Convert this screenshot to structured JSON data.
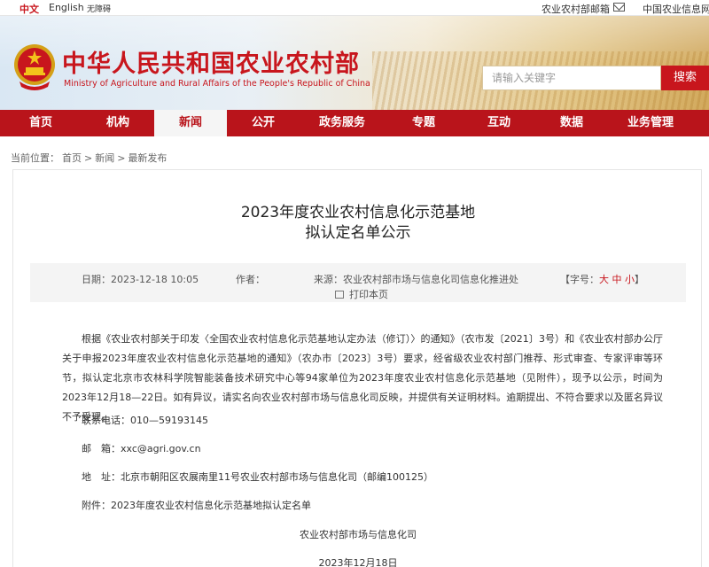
{
  "topbar": {
    "lang_cn": "中文",
    "lang_en": "English",
    "accessibility": "无障碍",
    "mail": "农业农村部邮箱",
    "site": "中国农业信息网"
  },
  "header": {
    "title": "中华人民共和国农业农村部",
    "subtitle": "Ministry of Agriculture and Rural Affairs of the People's Republic of China",
    "search_placeholder": "请输入关键字",
    "search_button": "搜索"
  },
  "nav": {
    "items": [
      "首页",
      "机构",
      "新闻",
      "公开",
      "政务服务",
      "专题",
      "互动",
      "数据",
      "业务管理"
    ],
    "active": "新闻"
  },
  "breadcrumb": {
    "label": "当前位置：",
    "items": [
      "首页",
      ">",
      "新闻",
      ">",
      "最新发布"
    ]
  },
  "article": {
    "title_line1": "2023年度农业农村信息化示范基地",
    "title_line2": "拟认定名单公示",
    "meta": {
      "date_label": "日期：",
      "date": "2023-12-18 10:05",
      "author_label": "作者：",
      "source_label": "来源：",
      "source": "农业农村部市场与信息化司信息化推进处",
      "print": "打印本页",
      "font_label": "【字号：",
      "font_large": "大",
      "font_medium": "中",
      "font_small": "小",
      "font_end": "】"
    },
    "paragraph": "根据《农业农村部关于印发〈全国农业农村信息化示范基地认定办法（修订）〉的通知》（农市发〔2021〕3号）和《农业农村部办公厅关于申报2023年度农业农村信息化示范基地的通知》（农办市〔2023〕3号）要求，经省级农业农村部门推荐、形式审查、专家评审等环节，拟认定北京市农林科学院智能装备技术研究中心等94家单位为2023年度农业农村信息化示范基地（见附件），现予以公示，时间为2023年12月18—22日。如有异议，请实名向农业农村部市场与信息化司反映，并提供有关证明材料。逾期提出、不符合要求以及匿名异议不予受理。",
    "phone": "联系电话：010—59193145",
    "email": "邮　箱：xxc@agri.gov.cn",
    "address": "地　址：北京市朝阳区农展南里11号农业农村部市场与信息化司（邮编100125）",
    "attachment": "附件：2023年度农业农村信息化示范基地拟认定名单",
    "signature": "农业农村部市场与信息化司",
    "sign_date": "2023年12月18日"
  }
}
